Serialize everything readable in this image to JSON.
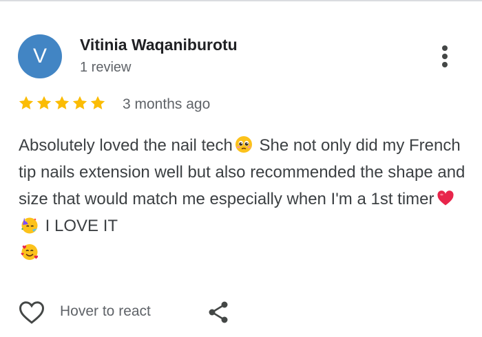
{
  "reviewer": {
    "initial": "V",
    "name": "Vitinia Waqaniburotu",
    "review_count": "1 review",
    "avatar_color": "#4285c4"
  },
  "rating": {
    "stars": 5,
    "max": 5,
    "star_color": "#fbbc04",
    "date": "3 months ago"
  },
  "review": {
    "segments": [
      "Absolutely loved the nail tech",
      " She not only did my French tip nails extension well but also recommended the shape and size that would match me especially when I'm a 1st timer",
      " I LOVE IT"
    ],
    "emojis": [
      "pleading-face-emoji",
      "red-heart-emoji",
      "partying-face-emoji",
      "smiling-face-with-hearts-emoji"
    ]
  },
  "actions": {
    "react_label": "Hover to react",
    "react_icon": "heart-outline-icon",
    "share_icon": "share-icon",
    "menu_icon": "more-vert-icon"
  }
}
